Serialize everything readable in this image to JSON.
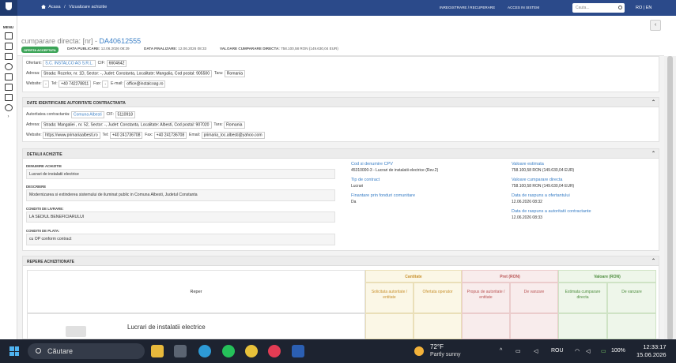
{
  "sidebar": {
    "menu_label": "MENU"
  },
  "topbar": {
    "breadcrumb_home": "Acasa",
    "breadcrumb_sep": "/",
    "breadcrumb_current": "Vizualizare achizitie",
    "register_link": "INREGISTRARE / RECUPERARE",
    "access_link": "ACCES IN SISTEM",
    "search_placeholder": "Cauta...",
    "lang_ro": "RO",
    "lang_sep": "|",
    "lang_en": "EN"
  },
  "header": {
    "title_prefix": "cumparare directa: [nr] - ",
    "code": "DA40612555",
    "status": "OFERTA ACCEPTATA",
    "publish_label": "DATA PUBLICARE:",
    "publish_value": "12.06.2026 08:29",
    "final_label": "DATA FINALIZARE:",
    "final_value": "12.06.2026 08:33",
    "value_label": "VALOARE CUMPARARE DIRECTA:",
    "value_value": "758.100,58 RON (149.630,04 EUR)"
  },
  "offerer": {
    "label": "Ofertant:",
    "name": "S.C. INSTALCO AG S.R.L.",
    "cif_label": "CIF:",
    "cif": "6604642",
    "address_label": "Adresa:",
    "address": "Strada: Rozelor, nr. 1D, Sector: -, Judet: Constanta, Localitate: Mangalia, Cod postal: 905500",
    "country_label": "Tara:",
    "country": "Romania",
    "website_label": "Website:",
    "website": "-",
    "tel_label": "Tel:",
    "tel": "+40 742278811",
    "fax_label": "Fax:",
    "fax": "-",
    "email_label": "E-mail:",
    "email": "office@instalcoag.ro"
  },
  "authority": {
    "section_title": "DATE IDENTIFICARE AUTORITATE CONTRACTANTA",
    "label": "Autoritatea contractanta:",
    "name": "Comuna Albesti",
    "cif_label": "CIF:",
    "cif": "5110918",
    "address_label": "Adresa:",
    "address": "Strada: Mangaliei , nr. 52, Sector: -, Judet: Constanta, Localitate: Albesti, Cod postal: 907020",
    "country_label": "Tara:",
    "country": "Romania",
    "website_label": "Website:",
    "website": "https://www.primariaalbesti.ro",
    "tel_label": "Tel:",
    "tel": "+40 241736708",
    "fax_label": "Fax:",
    "fax": "+40 241736708",
    "email_label": "Email:",
    "email": "primaria_loc.albesti@yahoo.com"
  },
  "details": {
    "section_title": "DETALII ACHIZITIE",
    "name_label": "DENUMIRE ACHIZITIE",
    "name_value": "Lucrari de instalatii electrice",
    "desc_label": "DESCRIERE",
    "desc_value": "Modernizarea si extinderea sistemului de iluminat public in Comuna Albesti, Judetul Constanta",
    "delivery_label": "CONDITII DE LIVRARE:",
    "delivery_value": "LA SEDIUL BENEFICIARULUI",
    "payment_label": "CONDITII DE PLATA:",
    "payment_value": "cu OP conform contract",
    "cpv_label": "Cod si denumire CPV",
    "cpv_value": "45310000-3 - Lucrari de instalatii electrice (Rev.2)",
    "contract_type_label": "Tip de contract",
    "contract_type_value": "Lucrari",
    "eu_funds_label": "Finantare prin fonduri comunitare",
    "eu_funds_value": "Da",
    "est_value_label": "Valoare estimata",
    "est_value_value": "758.100,58 RON (149.630,04 EUR)",
    "direct_value_label": "Valoare cumparare directa",
    "direct_value_value": "758.100,58 RON (149.630,04 EUR)",
    "resp_offerer_label": "Data de raspuns a ofertantului",
    "resp_offerer_value": "12.06.2026 08:32",
    "resp_authority_label": "Data de raspuns a autoritatii contractante",
    "resp_authority_value": "12.06.2026 08:33"
  },
  "items": {
    "section_title": "REPERE ACHIZITIONATE",
    "col_reper": "Reper",
    "grp_quantity": "Cantitate",
    "grp_price": "Pret (RON)",
    "grp_value": "Valoare (RON)",
    "sub_requested": "Solicitata autoritate / entitate",
    "sub_offer": "Ofertata operator",
    "sub_proposed": "Propus de autoritate / entitate",
    "sub_sale_price": "De vanzare",
    "sub_estimated": "Estimata cumparare directa",
    "sub_sale_value": "De vanzare",
    "row_name": "Lucrari de instalatii electrice"
  },
  "taskbar": {
    "search_placeholder": "Căutare",
    "weather_temp": "72°F",
    "weather_desc": "Partly sunny",
    "lang": "ROU",
    "battery": "100%",
    "time": "12:33:17",
    "date": "15.06.2026"
  }
}
